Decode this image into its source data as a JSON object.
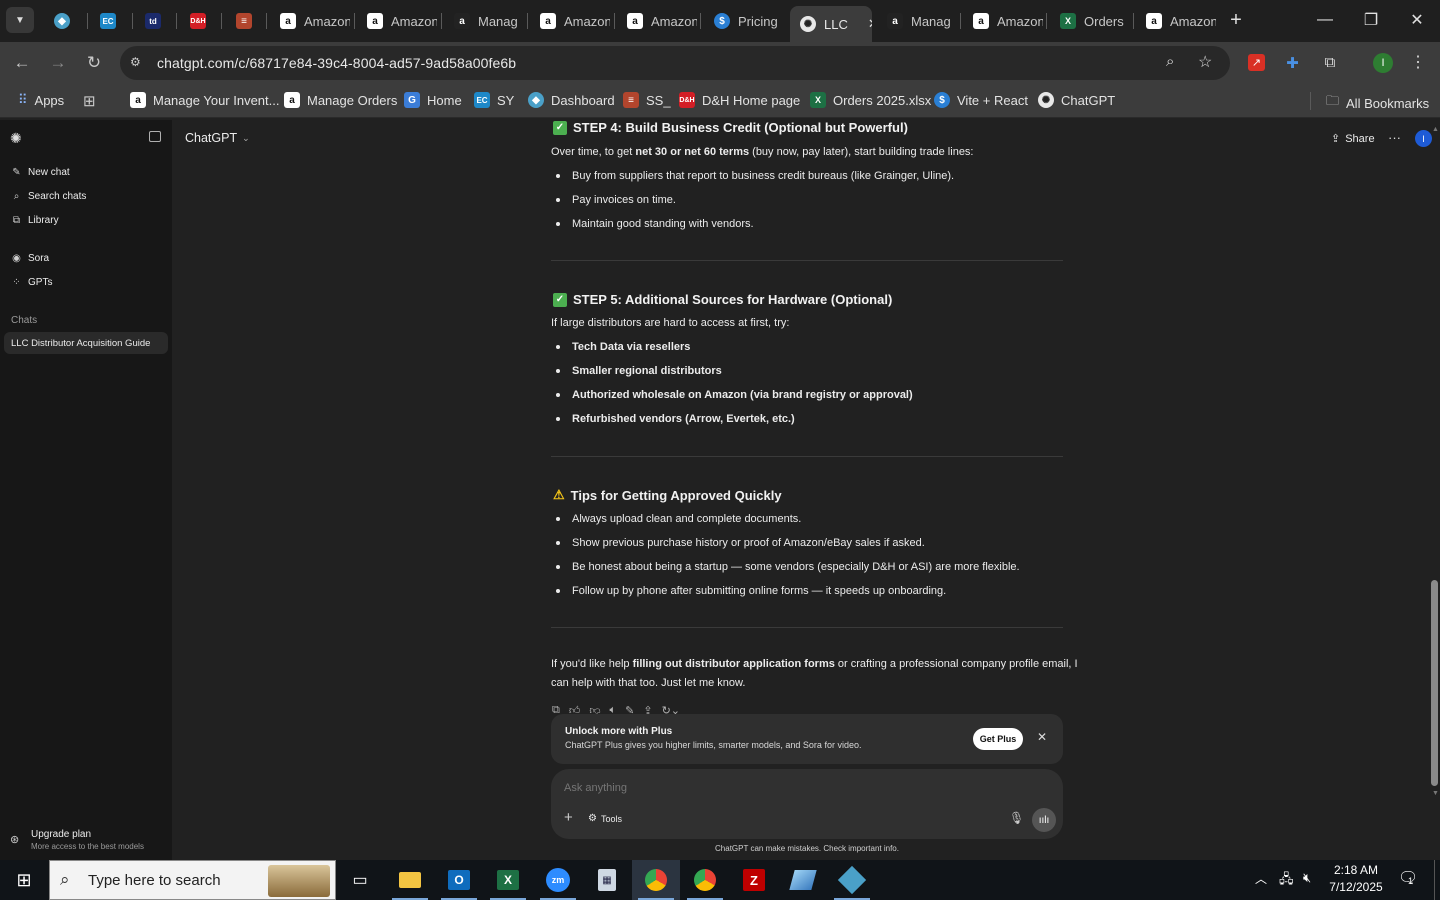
{
  "browser": {
    "tabs": [
      {
        "label": "",
        "icon": "colab-icon"
      },
      {
        "label": "",
        "icon": "ec-icon"
      },
      {
        "label": "",
        "icon": "tech-data-icon"
      },
      {
        "label": "",
        "icon": "dh-icon"
      },
      {
        "label": "",
        "icon": "stack-icon"
      },
      {
        "label": "Amazon",
        "icon": "amazon-icon"
      },
      {
        "label": "Amazon",
        "icon": "amazon-icon"
      },
      {
        "label": "Manag",
        "icon": "amazon-icon"
      },
      {
        "label": "Amazon",
        "icon": "amazon-icon"
      },
      {
        "label": "Amazon",
        "icon": "amazon-icon"
      },
      {
        "label": "Pricing",
        "icon": "dollar-icon"
      },
      {
        "label": "LLC",
        "icon": "chatgpt-icon"
      },
      {
        "label": "Manag",
        "icon": "amazon-icon"
      },
      {
        "label": "Amazon",
        "icon": "amazon-icon"
      },
      {
        "label": "Orders",
        "icon": "excel-icon"
      },
      {
        "label": "Amazon",
        "icon": "amazon-icon"
      }
    ],
    "url": "chatgpt.com/c/68717e84-39c4-8004-ad57-9ad58a00fe6b",
    "bookmarks": [
      "Apps",
      "Manage Your Invent...",
      "Manage Orders",
      "Home",
      "SY",
      "Dashboard",
      "SS_",
      "D&H Home page",
      "Orders 2025.xlsx",
      "Vite + React",
      "ChatGPT"
    ],
    "all_bookmarks": "All Bookmarks"
  },
  "sidebar": {
    "new_chat": "New chat",
    "search_chats": "Search chats",
    "library": "Library",
    "sora": "Sora",
    "gpts": "GPTs",
    "chats_heading": "Chats",
    "chat_item": "LLC Distributor Acquisition Guide",
    "upgrade_title": "Upgrade plan",
    "upgrade_sub": "More access to the best models"
  },
  "header": {
    "model": "ChatGPT",
    "share": "Share",
    "avatar_letter": "I"
  },
  "content": {
    "step4_title": "STEP 4: Build Business Credit (Optional but Powerful)",
    "step4_intro_a": "Over time, to get ",
    "step4_intro_b": "net 30 or net 60 terms",
    "step4_intro_c": " (buy now, pay later), start building trade lines:",
    "step4_items": [
      "Buy from suppliers that report to business credit bureaus (like Grainger, Uline).",
      "Pay invoices on time.",
      "Maintain good standing with vendors."
    ],
    "step5_title": "STEP 5: Additional Sources for Hardware (Optional)",
    "step5_intro": "If large distributors are hard to access at first, try:",
    "step5_items": [
      "Tech Data via resellers",
      "Smaller regional distributors",
      "Authorized wholesale on Amazon (via brand registry or approval)",
      "Refurbished vendors (Arrow, Evertek, etc.)"
    ],
    "tips_title": "Tips for Getting Approved Quickly",
    "tips_items": [
      "Always upload clean and complete documents.",
      "Show previous purchase history or proof of Amazon/eBay sales if asked.",
      "Be honest about being a startup — some vendors (especially D&H or ASI) are more flexible.",
      "Follow up by phone after submitting online forms — it speeds up onboarding."
    ],
    "closing_a": "If you'd like help ",
    "closing_b": "filling out distributor application forms",
    "closing_c": " or crafting a professional company profile email, I",
    "closing_line2": "can help with that too. Just let me know."
  },
  "promo": {
    "title": "Unlock more with Plus",
    "subtitle": "ChatGPT Plus gives you higher limits, smarter models, and Sora for video.",
    "button": "Get Plus"
  },
  "composer": {
    "placeholder": "Ask anything",
    "tools": "Tools",
    "disclaimer": "ChatGPT can make mistakes. Check important info."
  },
  "taskbar": {
    "search_placeholder": "Type here to search",
    "time": "2:18 AM",
    "date": "7/12/2025",
    "notification_count": "1"
  },
  "colors": {
    "accent_green": "#4caf50",
    "warning_yellow": "#f5c518",
    "page_bg": "#212121",
    "sidebar_bg": "#171717"
  }
}
